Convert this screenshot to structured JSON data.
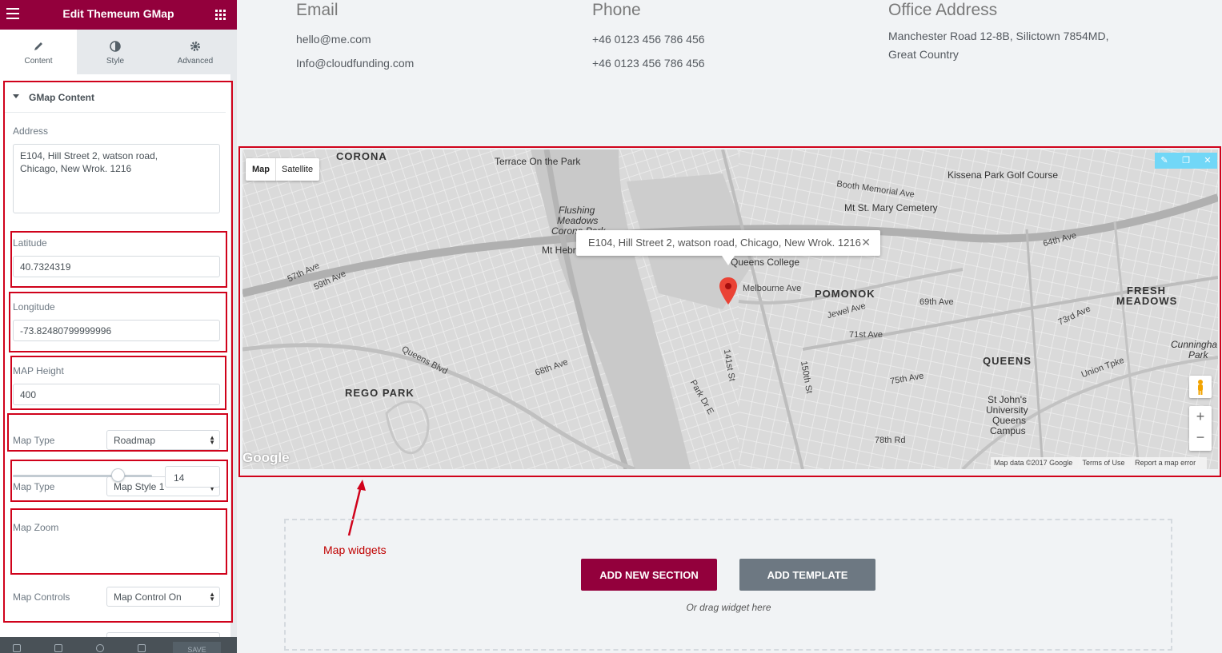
{
  "sidebar": {
    "title": "Edit Themeum GMap",
    "tabs": [
      {
        "label": "Content",
        "icon": "pencil-icon"
      },
      {
        "label": "Style",
        "icon": "contrast-icon"
      },
      {
        "label": "Advanced",
        "icon": "gear-icon"
      }
    ],
    "section_title": "GMap Content",
    "address_label": "Address",
    "address_value": "E104, Hill Street 2, watson road,\nChicago, New Wrok. 1216",
    "latitude_label": "Latitude",
    "latitude_value": "40.7324319",
    "longitude_label": "Longitude",
    "longitude_value": "-73.82480799999996",
    "height_label": "MAP Height",
    "height_value": "400",
    "map_type_label": "Map Type",
    "map_type_value": "Roadmap",
    "map_style_label": "Map Type",
    "map_style_value": "Map Style 1",
    "zoom_label": "Map Zoom",
    "zoom_value": "14",
    "zoom_fraction": 0.75,
    "controls_label": "Map Controls",
    "controls_value": "Map Control On",
    "footer_save": "SAVE"
  },
  "contact": {
    "email_heading": "Email",
    "email_1": "hello@me.com",
    "email_2": "Info@cloudfunding.com",
    "phone_heading": "Phone",
    "phone_1": "+46 0123 456 786 456",
    "phone_2": "+46 0123 456 786 456",
    "office_heading": "Office Address",
    "office_1": "Manchester Road 12-8B, Silictown 7854MD,",
    "office_2": "Great Country"
  },
  "map": {
    "type_map": "Map",
    "type_satellite": "Satellite",
    "info_text": "E104, Hill Street 2, watson road, Chicago, New Wrok. 1216",
    "info_close": "✕",
    "google_logo": "Google",
    "attribution": [
      "Map data ©2017 Google",
      "Terms of Use",
      "Report a map error"
    ],
    "zoom_in": "+",
    "zoom_out": "−",
    "labels": {
      "corona": "CORONA",
      "terrace": "Terrace On the Park",
      "flushing": "Flushing",
      "meadows": "Meadows",
      "corona_park": "Corona Park",
      "mt_hebron": "Mt Hebr",
      "queens_college": "Queens College",
      "melbourne": "Melbourne Ave",
      "pomonok": "POMONOK",
      "kissena_golf": "Kissena Park Golf Course",
      "booth": "Booth Memorial Ave",
      "mt_st_mary": "Mt St. Mary Cemetery",
      "fresh": "FRESH",
      "fresh_meadows": "MEADOWS",
      "queens": "QUEENS",
      "rego_park": "REGO PARK",
      "st_johns_1": "St John's",
      "st_johns_2": "University",
      "st_johns_3": "Queens",
      "st_johns_4": "Campus",
      "cunningham_1": "Cunningha",
      "cunningham_2": "Park",
      "jewel": "Jewel Ave",
      "ave_71": "71st Ave",
      "queens_blvd": "Queens Blvd",
      "ave_69": "69th Ave",
      "ave_59": "59th Ave",
      "ave_57": "57th Ave",
      "ave_75": "75th Ave",
      "ave_73": "73rd Ave",
      "ave_68": "68th Ave",
      "union": "Union Tpke",
      "ave_64": "64th Ave",
      "ave_78": "78th Rd",
      "park_dr": "Park Dr E",
      "st_141": "141st St",
      "st_150": "150th St"
    }
  },
  "annotation": "Map widgets",
  "actions": {
    "add_section": "ADD NEW SECTION",
    "add_template": "ADD TEMPLATE",
    "drag_hint": "Or drag widget here"
  },
  "colors": {
    "brand": "#93003c",
    "annotation_red": "#d0021b",
    "template_button": "#6d7882",
    "edit_tools": "#71d7f7"
  }
}
